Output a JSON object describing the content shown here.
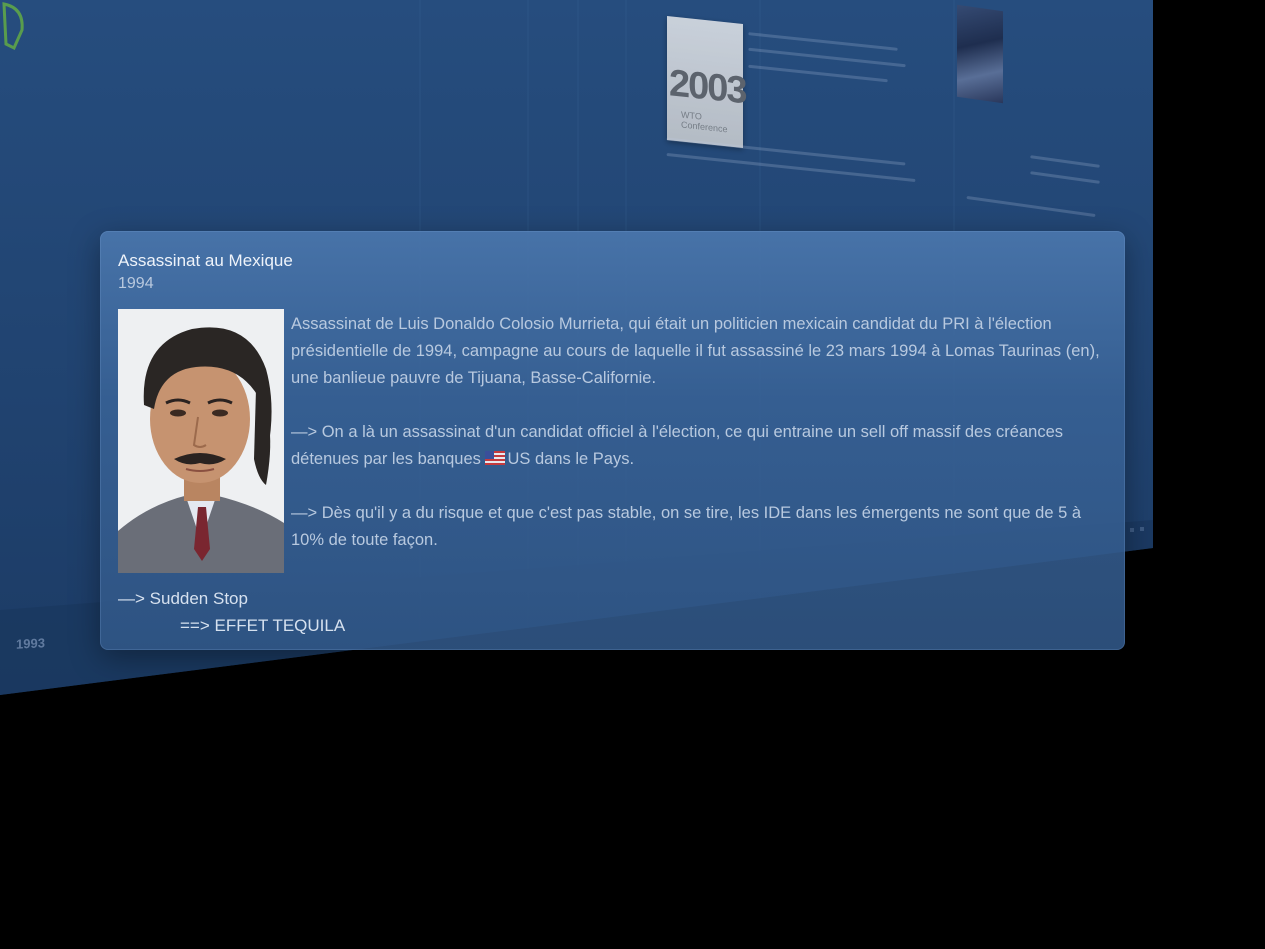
{
  "background": {
    "bg_card_year": "2003",
    "bg_card_subtitle": "WTO Conference",
    "timeline_year_label": "1993"
  },
  "event": {
    "title": "Assassinat au Mexique",
    "year": "1994",
    "photo_alt": "Luis Donaldo Colosio Murrieta",
    "paragraph_1": "Assassinat de Luis Donaldo Colosio Murrieta, qui était un politicien mexicain candidat du PRI à l'élection présidentielle de 1994, campagne au cours de laquelle il fut assassiné le 23 mars 1994 à Lomas Taurinas (en), une banlieue pauvre de Tijuana, Basse-Californie.",
    "paragraph_2_before_flag": "—> On a là un assassinat d'un candidat officiel à l'élection, ce qui entraine un sell off massif des créances détenues par les banques ",
    "paragraph_2_flag": "us-flag-icon",
    "paragraph_2_after_flag": "US dans le Pays.",
    "paragraph_3": "—> Dès qu'il y a du risque et que c'est pas stable, on se tire, les IDE dans les émergents ne sont que de 5 à 10% de toute façon.",
    "footer_line_1": "—> Sudden Stop",
    "footer_line_2": "==> EFFET  TEQUILA"
  },
  "colors": {
    "wall_top": "#244a7a",
    "wall_bottom": "#1d3c66",
    "popup": "#4a76ac",
    "body_text": "#b8c9df"
  }
}
